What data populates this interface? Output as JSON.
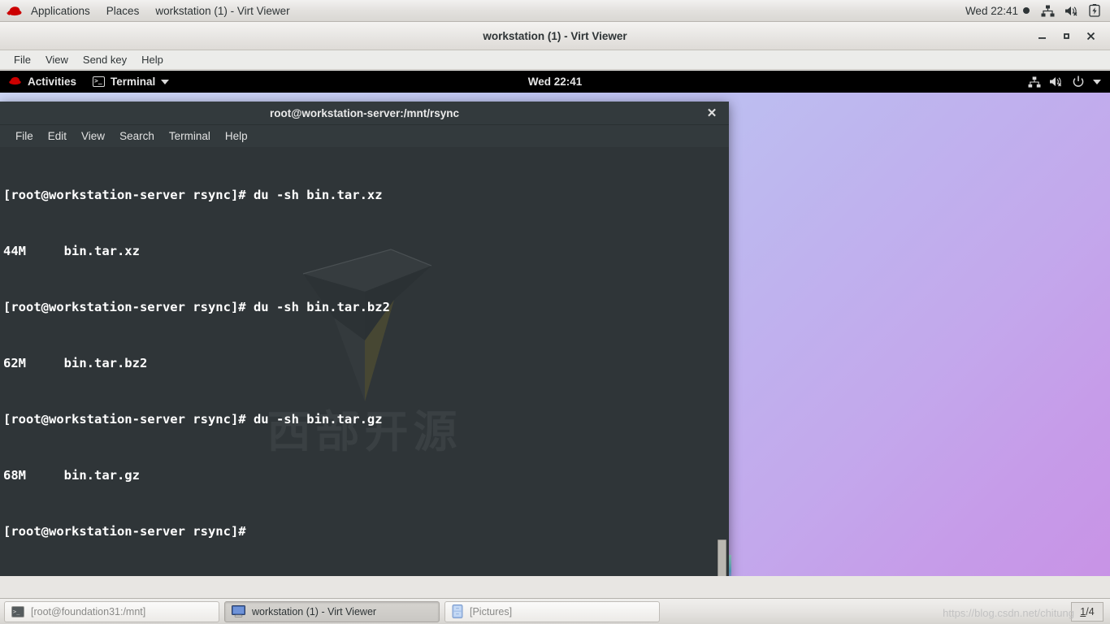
{
  "host_panel": {
    "logo": "redhat-logo",
    "menus": [
      "Applications",
      "Places"
    ],
    "window_title": "workstation (1) - Virt Viewer",
    "clock": "Wed 22:41",
    "icons": [
      "network-icon",
      "volume-muted-icon",
      "battery-icon"
    ]
  },
  "virt_viewer": {
    "title": "workstation (1) - Virt Viewer",
    "menus": [
      "File",
      "View",
      "Send key",
      "Help"
    ],
    "controls": {
      "minimize": "–",
      "maximize": "▫",
      "close": "✕"
    }
  },
  "guest_topbar": {
    "activities": "Activities",
    "app_name": "Terminal",
    "clock": "Wed 22:41",
    "icons": [
      "network-icon",
      "volume-muted-icon",
      "power-icon",
      "chevron-down-icon"
    ]
  },
  "terminal": {
    "title": "root@workstation-server:/mnt/rsync",
    "close_label": "✕",
    "menus": [
      "File",
      "Edit",
      "View",
      "Search",
      "Terminal",
      "Help"
    ],
    "watermark_text": "西部开源",
    "lines": [
      "[root@workstation-server rsync]# du -sh bin.tar.xz",
      "44M\tbin.tar.xz",
      "[root@workstation-server rsync]# du -sh bin.tar.bz2",
      "62M\tbin.tar.bz2",
      "[root@workstation-server rsync]# du -sh bin.tar.gz",
      "68M\tbin.tar.gz",
      "[root@workstation-server rsync]#"
    ]
  },
  "taskbar": {
    "items": [
      {
        "label": "[root@foundation31:/mnt]",
        "icon": "terminal-icon",
        "active": false
      },
      {
        "label": "workstation (1) - Virt Viewer",
        "icon": "monitor-icon",
        "active": true
      },
      {
        "label": "[Pictures]",
        "icon": "drawer-icon",
        "active": false
      }
    ],
    "watermark": "https://blog.csdn.net/chitung",
    "workspace_current": "1",
    "workspace_separator": "/",
    "workspace_total": "4"
  },
  "colors": {
    "terminal_bg": "#2f3538",
    "terminal_chrome": "#333a3d",
    "guest_panel": "#000000",
    "accent_red": "#cc0000"
  }
}
